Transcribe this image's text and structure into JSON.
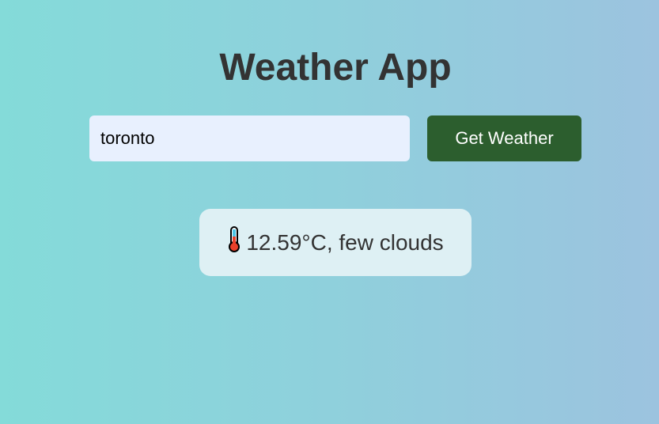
{
  "title": "Weather App",
  "search": {
    "value": "toronto"
  },
  "button": {
    "label": "Get Weather"
  },
  "result": {
    "text": "12.59°C, few clouds",
    "icon": "thermometer-icon"
  }
}
